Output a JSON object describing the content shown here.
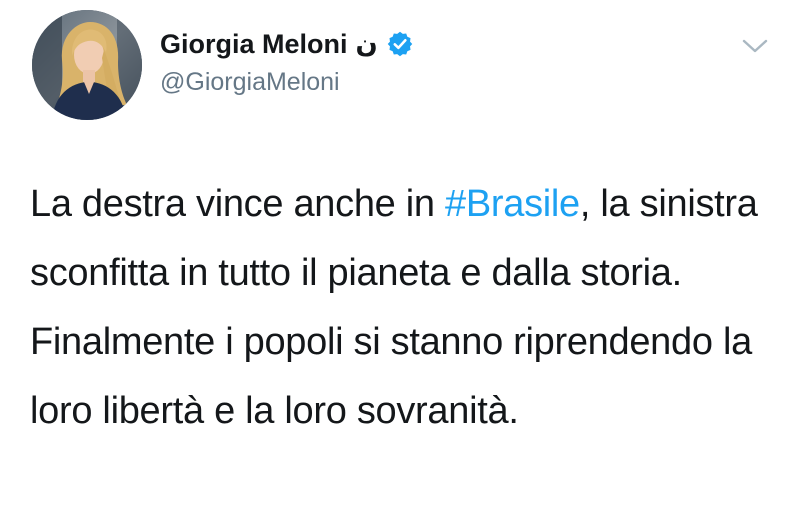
{
  "author": {
    "display_name": "Giorgia Meloni",
    "name_suffix": "ن",
    "handle": "@GiorgiaMeloni",
    "verified": true
  },
  "tweet": {
    "text_before_hashtag": "La destra vince anche in ",
    "hashtag": "#Brasile",
    "text_after_hashtag": ", la sinistra sconfitta in tutto il pianeta e dalla storia. Finalmente i popoli si stanno riprendendo la loro libertà e la loro sovranità."
  },
  "icons": {
    "verified": "verified-badge-icon",
    "menu": "chevron-down-icon"
  },
  "colors": {
    "hashtag": "#1da1f2",
    "verified_badge": "#1da1f2",
    "handle": "#657786",
    "text": "#14171a"
  }
}
